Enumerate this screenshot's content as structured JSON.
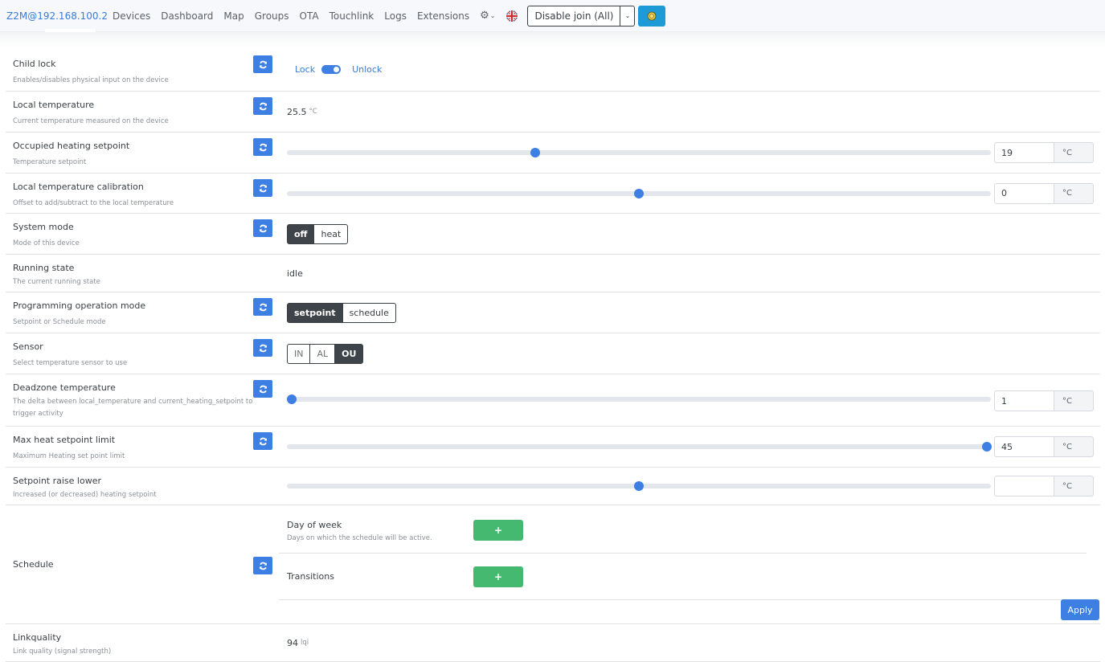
{
  "navbar": {
    "brand": "Z2M@192.168.100.2",
    "links": [
      "Devices",
      "Dashboard",
      "Map",
      "Groups",
      "OTA",
      "Touchlink",
      "Logs",
      "Extensions"
    ],
    "settings_icon": "gear-icon",
    "language_icon": "uk-flag-icon",
    "join_button": "Disable join (All)",
    "join_dropdown_icon": "chevron-down-icon",
    "theme_icon": "sun-icon"
  },
  "accent_colors": {
    "primary": "#3d7fe3",
    "success": "#46b970",
    "dark": "#3f444b",
    "info": "#1e9bd7"
  },
  "rows": {
    "child_lock": {
      "title": "Child lock",
      "desc": "Enables/disables physical input on the device",
      "off_label": "Lock",
      "on_label": "Unlock",
      "state": "on"
    },
    "local_temperature": {
      "title": "Local temperature",
      "desc": "Current temperature measured on the device",
      "value": "25.5",
      "unit": "°C"
    },
    "occupied_heating_setpoint": {
      "title": "Occupied heating setpoint",
      "desc": "Temperature setpoint",
      "value": "19",
      "unit": "°C",
      "slider_fraction": 0.353
    },
    "local_temperature_calibration": {
      "title": "Local temperature calibration",
      "desc": "Offset to add/subtract to the local temperature",
      "value": "0",
      "unit": "°C",
      "slider_fraction": 0.5
    },
    "system_mode": {
      "title": "System mode",
      "desc": "Mode of this device",
      "options": [
        "off",
        "heat"
      ],
      "selected": "off"
    },
    "running_state": {
      "title": "Running state",
      "desc": "The current running state",
      "value": "idle"
    },
    "programming_operation_mode": {
      "title": "Programming operation mode",
      "desc": "Setpoint or Schedule mode",
      "options": [
        "setpoint",
        "schedule"
      ],
      "selected": "setpoint"
    },
    "sensor": {
      "title": "Sensor",
      "desc": "Select temperature sensor to use",
      "options": [
        "IN",
        "AL",
        "OU"
      ],
      "selected": "OU"
    },
    "deadzone_temperature": {
      "title": "Deadzone temperature",
      "desc": "The delta between local_temperature and current_heating_setpoint to trigger activity",
      "value": "1",
      "unit": "°C",
      "slider_fraction": 0.007
    },
    "max_heat_setpoint_limit": {
      "title": "Max heat setpoint limit",
      "desc": "Maximum Heating set point limit",
      "value": "45",
      "unit": "°C",
      "slider_fraction": 0.994
    },
    "setpoint_raise_lower": {
      "title": "Setpoint raise lower",
      "desc": "Increased (or decreased) heating setpoint",
      "value": "",
      "unit": "°C",
      "slider_fraction": 0.5
    },
    "schedule": {
      "title": "Schedule",
      "day_of_week": {
        "title": "Day of week",
        "desc": "Days on which the schedule will be active.",
        "add_label": "+"
      },
      "transitions": {
        "title": "Transitions",
        "add_label": "+"
      },
      "apply_label": "Apply"
    },
    "linkquality": {
      "title": "Linkquality",
      "desc": "Link quality (signal strength)",
      "value": "94",
      "unit": "lqi"
    }
  }
}
